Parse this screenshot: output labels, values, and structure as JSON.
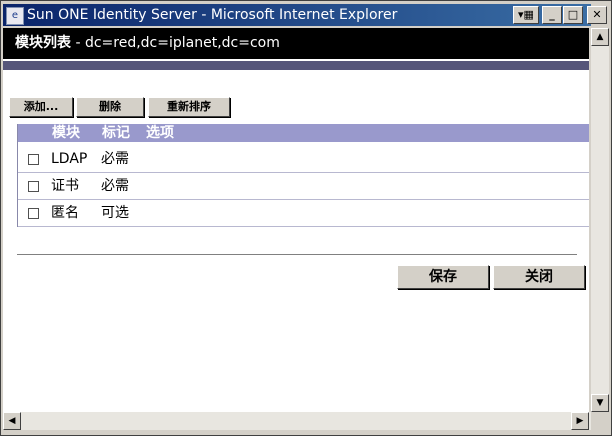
{
  "window": {
    "title": "Sun ONE Identity Server - Microsoft Internet Explorer",
    "icon_name": "ie-page-icon",
    "controls": {
      "help": "▾▦",
      "minimize": "_",
      "maximize": "□",
      "close": "✕"
    }
  },
  "header": {
    "title": "模块列表",
    "subtitle": "- dc=red,dc=iplanet,dc=com"
  },
  "actions": {
    "add_label": "添加...",
    "delete_label": "删除",
    "reorder_label": "重新排序"
  },
  "table": {
    "columns": [
      "模块",
      "标记",
      "选项"
    ],
    "rows": [
      {
        "module": "LDAP",
        "flag": "必需"
      },
      {
        "module": "证书",
        "flag": "必需"
      },
      {
        "module": "匿名",
        "flag": "可选"
      }
    ]
  },
  "footer": {
    "save_label": "保存",
    "close_label": "关闭"
  },
  "colors": {
    "titlebar_start": "#0a246a",
    "titlebar_end": "#3a6ea5",
    "header_bar": "#000000",
    "accent_bar": "#55557a",
    "table_header": "#9999cc"
  }
}
